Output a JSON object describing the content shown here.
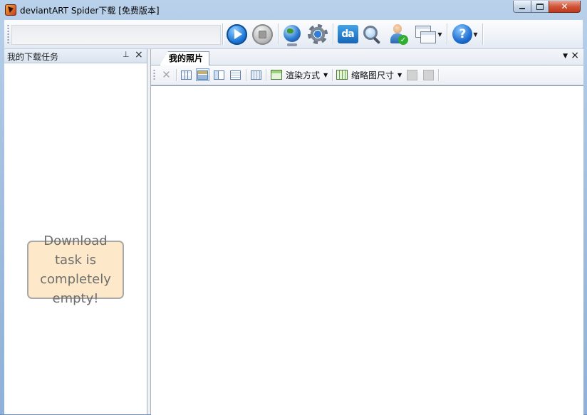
{
  "window": {
    "title": "deviantART Spider下载 [免费版本]",
    "controls": {
      "minimize": "",
      "maximize": "",
      "close": "✕"
    }
  },
  "toolbar": {
    "address_value": "",
    "buttons": [
      {
        "name": "start",
        "icon": "play-icon"
      },
      {
        "name": "stop",
        "icon": "stop-icon"
      },
      {
        "name": "network",
        "icon": "globe-icon"
      },
      {
        "name": "settings",
        "icon": "gear-icon"
      },
      {
        "name": "deviantart",
        "icon": "deviantart-icon",
        "label": "da"
      },
      {
        "name": "search",
        "icon": "search-icon"
      },
      {
        "name": "account",
        "icon": "user-check-icon"
      },
      {
        "name": "windows",
        "icon": "windows-icon"
      },
      {
        "name": "help",
        "icon": "help-icon",
        "label": "?"
      }
    ]
  },
  "left_panel": {
    "title": "我的下载任务",
    "pin": "ᵖ",
    "close": "×",
    "empty_message": "Download task is completely empty!"
  },
  "document": {
    "tab_label": "我的照片",
    "tab_menu": "▼",
    "tab_close": "×",
    "subtoolbar": {
      "render_mode_label": "渲染方式",
      "thumb_size_label": "缩略图尺寸"
    }
  },
  "colors": {
    "title_gradient_top": "#b9d1ea",
    "note_bg": "#fde9c9",
    "accent_blue": "#1b74d4"
  }
}
